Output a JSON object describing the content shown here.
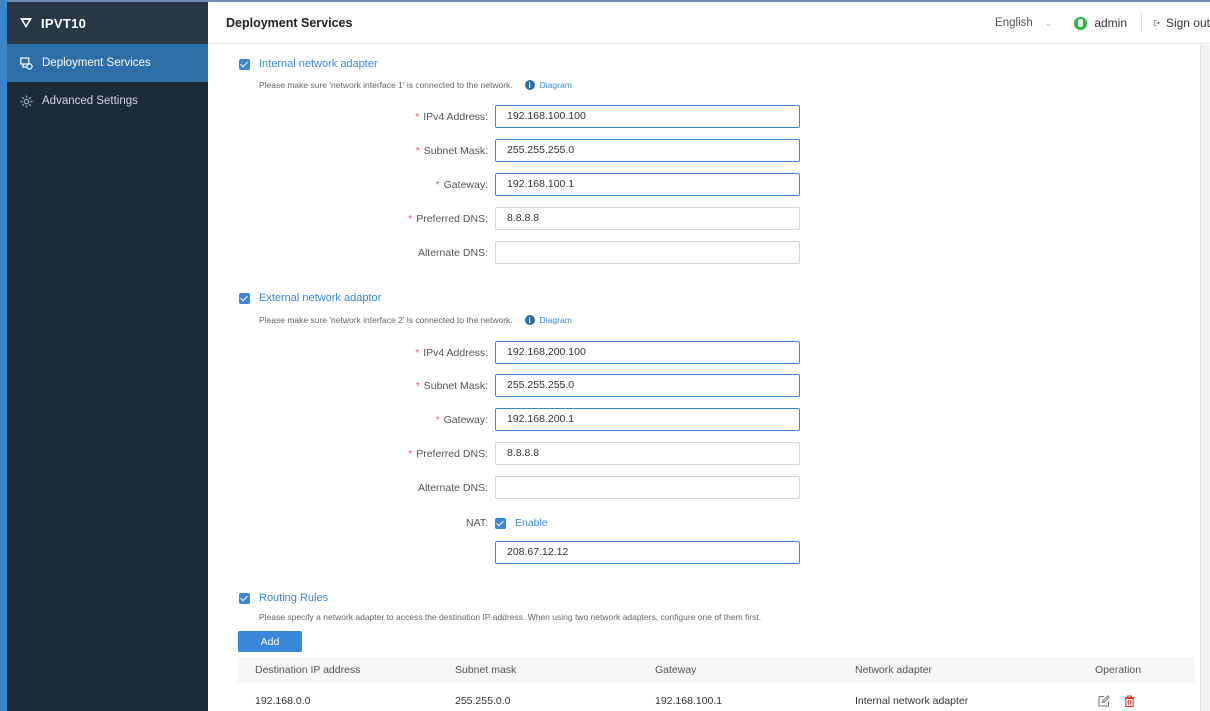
{
  "app": {
    "title": "IPVT10"
  },
  "sidebar": {
    "items": [
      {
        "label": "Deployment Services",
        "icon": "deployment-icon",
        "active": true
      },
      {
        "label": "Advanced Settings",
        "icon": "gear-icon",
        "active": false
      }
    ]
  },
  "header": {
    "title": "Deployment Services",
    "language": "English",
    "user": "admin",
    "signout": "Sign out"
  },
  "internal": {
    "heading": "Internal network adapter",
    "hint": "Please make sure 'network interface 1' is connected to the network.",
    "diagram": "Diagram",
    "ipv4_label": "IPv4 Address:",
    "ipv4": "192.168.100.100",
    "mask_label": "Subnet Mask:",
    "mask": "255.255.255.0",
    "gateway_label": "Gateway:",
    "gateway": "192.168.100.1",
    "pdns_label": "Preferred DNS:",
    "pdns": "8.8.8.8",
    "adns_label": "Alternate DNS:",
    "adns": ""
  },
  "external": {
    "heading": "External network adaptor",
    "hint": "Please make sure 'network interface 2' is connected to the network.",
    "diagram": "Diagram",
    "ipv4_label": "IPv4 Address:",
    "ipv4": "192.168.200.100",
    "mask_label": "Subnet Mask:",
    "mask": "255.255.255.0",
    "gateway_label": "Gateway:",
    "gateway": "192.168.200.1",
    "pdns_label": "Preferred DNS:",
    "pdns": "8.8.8.8",
    "adns_label": "Alternate DNS:",
    "adns": "",
    "nat_label": "NAT:",
    "nat_enable": "Enable",
    "nat_ip": "208.67.12.12"
  },
  "routing": {
    "heading": "Routing Rules",
    "hint": "Please specify a network adapter to access the destination IP address. When using two network adapters, configure one of them first.",
    "add": "Add",
    "columns": [
      "Destination IP address",
      "Subnet mask",
      "Gateway",
      "Network adapter",
      "Operation"
    ],
    "rows": [
      {
        "dest": "192.168.0.0",
        "mask": "255.255.0.0",
        "gateway": "192.168.100.1",
        "adapter": "Internal network adapter"
      }
    ]
  },
  "colors": {
    "accent": "#3a86d8",
    "sidebar": "#1f2a37",
    "active": "#2e6ea6",
    "danger": "#e53935"
  }
}
